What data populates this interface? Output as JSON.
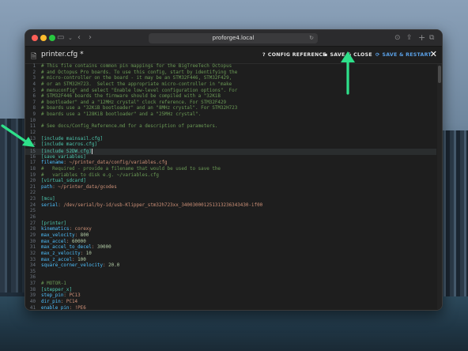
{
  "browser": {
    "url": "proforge4.local"
  },
  "toolbar": {
    "file_title": "printer.cfg *",
    "config_reference": "CONFIG REFERENCE",
    "save_close": "SAVE & CLOSE",
    "save_restart": "SAVE & RESTART"
  },
  "editor": {
    "lines": [
      {
        "n": "1",
        "parts": [
          {
            "c": "cm",
            "t": "# This file contains common pin mappings for the BigTreeTech Octopus"
          }
        ]
      },
      {
        "n": "2",
        "parts": [
          {
            "c": "cm",
            "t": "# and Octopus Pro boards. To use this config, start by identifying the"
          }
        ]
      },
      {
        "n": "3",
        "parts": [
          {
            "c": "cm",
            "t": "# micro-controller on the board - it may be an STM32F446, STM32F429,"
          }
        ]
      },
      {
        "n": "4",
        "parts": [
          {
            "c": "cm",
            "t": "# or an STM32H723.  Select the appropriate micro-controller in \"make"
          }
        ]
      },
      {
        "n": "5",
        "parts": [
          {
            "c": "cm",
            "t": "# menuconfig\" and select \"Enable low-level configuration options\". For"
          }
        ]
      },
      {
        "n": "6",
        "parts": [
          {
            "c": "cm",
            "t": "# STM32F446 boards the firmware should be compiled with a \"32KiB"
          }
        ]
      },
      {
        "n": "7",
        "parts": [
          {
            "c": "cm",
            "t": "# bootloader\" and a \"12MHz crystal\" clock reference. For STM32F429"
          }
        ]
      },
      {
        "n": "8",
        "parts": [
          {
            "c": "cm",
            "t": "# boards use a \"32KiB bootloader\" and an \"8MHz crystal\". For STM32H723"
          }
        ]
      },
      {
        "n": "9",
        "parts": [
          {
            "c": "cm",
            "t": "# boards use a \"128KiB bootloader\" and a \"25MHz crystal\"."
          }
        ]
      },
      {
        "n": "10",
        "parts": []
      },
      {
        "n": "11",
        "parts": [
          {
            "c": "cm",
            "t": "# See docs/Config_Reference.md for a description of parameters."
          }
        ]
      },
      {
        "n": "12",
        "parts": []
      },
      {
        "n": "13",
        "parts": [
          {
            "c": "sec",
            "t": "[include mainsail.cfg]"
          }
        ]
      },
      {
        "n": "14",
        "parts": [
          {
            "c": "sec",
            "t": "[include macros.cfg]"
          }
        ]
      },
      {
        "n": "15",
        "hl": true,
        "cursor": true,
        "parts": [
          {
            "c": "sec",
            "t": "[include S2DW.cfg]"
          }
        ]
      },
      {
        "n": "16",
        "parts": [
          {
            "c": "sec",
            "t": "[save_variables]"
          }
        ]
      },
      {
        "n": "17",
        "parts": [
          {
            "c": "k",
            "t": "filename"
          },
          {
            "c": "t",
            "t": ": ~/printer_data/config/variables.cfg"
          }
        ]
      },
      {
        "n": "18",
        "parts": [
          {
            "c": "cm",
            "t": "#   Required - provide a filename that would be used to save the"
          }
        ]
      },
      {
        "n": "19",
        "parts": [
          {
            "c": "cm",
            "t": "#   variables to disk e.g. ~/variables.cfg"
          }
        ]
      },
      {
        "n": "20",
        "parts": [
          {
            "c": "sec",
            "t": "[virtual_sdcard]"
          }
        ]
      },
      {
        "n": "21",
        "parts": [
          {
            "c": "k",
            "t": "path"
          },
          {
            "c": "t",
            "t": ": ~/printer_data/gcodes"
          }
        ]
      },
      {
        "n": "22",
        "parts": []
      },
      {
        "n": "23",
        "parts": [
          {
            "c": "sec",
            "t": "[mcu]"
          }
        ]
      },
      {
        "n": "24",
        "parts": [
          {
            "c": "k",
            "t": "serial"
          },
          {
            "c": "t",
            "t": ": /dev/serial/by-id/usb-Klipper_stm32h723xx_340030001251313236343430-if00"
          }
        ]
      },
      {
        "n": "25",
        "parts": []
      },
      {
        "n": "26",
        "parts": []
      },
      {
        "n": "27",
        "parts": [
          {
            "c": "sec",
            "t": "[printer]"
          }
        ]
      },
      {
        "n": "28",
        "parts": [
          {
            "c": "k",
            "t": "kinematics"
          },
          {
            "c": "t",
            "t": ": corexy"
          }
        ]
      },
      {
        "n": "29",
        "parts": [
          {
            "c": "k",
            "t": "max_velocity"
          },
          {
            "c": "t",
            "t": ": "
          },
          {
            "c": "v",
            "t": "800"
          }
        ]
      },
      {
        "n": "30",
        "parts": [
          {
            "c": "k",
            "t": "max_accel"
          },
          {
            "c": "t",
            "t": ": "
          },
          {
            "c": "v",
            "t": "60000"
          }
        ]
      },
      {
        "n": "31",
        "parts": [
          {
            "c": "k",
            "t": "max_accel_to_decel"
          },
          {
            "c": "t",
            "t": ": "
          },
          {
            "c": "v",
            "t": "30000"
          }
        ]
      },
      {
        "n": "32",
        "parts": [
          {
            "c": "k",
            "t": "max_z_velocity"
          },
          {
            "c": "t",
            "t": ": "
          },
          {
            "c": "v",
            "t": "10"
          }
        ]
      },
      {
        "n": "33",
        "parts": [
          {
            "c": "k",
            "t": "max_z_accel"
          },
          {
            "c": "t",
            "t": ": "
          },
          {
            "c": "v",
            "t": "100"
          }
        ]
      },
      {
        "n": "34",
        "parts": [
          {
            "c": "k",
            "t": "square_corner_velocity"
          },
          {
            "c": "t",
            "t": ": "
          },
          {
            "c": "v",
            "t": "20.0"
          }
        ]
      },
      {
        "n": "35",
        "parts": []
      },
      {
        "n": "36",
        "parts": []
      },
      {
        "n": "37",
        "parts": [
          {
            "c": "cm",
            "t": "# MOTOR-1"
          }
        ]
      },
      {
        "n": "38",
        "parts": [
          {
            "c": "sec",
            "t": "[stepper_x]"
          }
        ]
      },
      {
        "n": "39",
        "parts": [
          {
            "c": "k",
            "t": "step_pin"
          },
          {
            "c": "t",
            "t": ": PC13"
          }
        ]
      },
      {
        "n": "40",
        "parts": [
          {
            "c": "k",
            "t": "dir_pin"
          },
          {
            "c": "t",
            "t": ": PC14"
          }
        ]
      },
      {
        "n": "41",
        "parts": [
          {
            "c": "k",
            "t": "enable_pin"
          },
          {
            "c": "t",
            "t": ": !PE6"
          }
        ]
      }
    ]
  },
  "colors": {
    "annotation_arrow": "#2ee08a",
    "accent_blue": "#5aa0e6"
  }
}
